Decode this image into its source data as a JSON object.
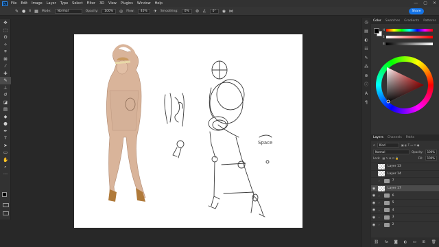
{
  "menubar": {
    "app_icon": "Ps",
    "items": [
      "File",
      "Edit",
      "Image",
      "Layer",
      "Type",
      "Select",
      "Filter",
      "3D",
      "View",
      "Plugins",
      "Window",
      "Help"
    ],
    "window_controls": [
      "—",
      "▢",
      "✕"
    ]
  },
  "options_bar": {
    "mode_label": "Mode:",
    "mode_value": "Normal",
    "opacity_label": "Opacity:",
    "opacity_value": "100%",
    "flow_label": "Flow:",
    "flow_value": "40%",
    "smoothing_label": "Smoothing:",
    "smoothing_value": "0%",
    "angle_value": "0°",
    "brush_size": "8",
    "share_label": "Share"
  },
  "toolbar": {
    "tools": [
      {
        "name": "move-tool-icon",
        "glyph": "✥"
      },
      {
        "name": "marquee-tool-icon",
        "glyph": "⬚"
      },
      {
        "name": "lasso-tool-icon",
        "glyph": "ʘ"
      },
      {
        "name": "magic-wand-tool-icon",
        "glyph": "✧"
      },
      {
        "name": "crop-tool-icon",
        "glyph": "⌗"
      },
      {
        "name": "frame-tool-icon",
        "glyph": "⊠"
      },
      {
        "name": "eyedropper-tool-icon",
        "glyph": "⁄"
      },
      {
        "name": "healing-brush-tool-icon",
        "glyph": "✚"
      },
      {
        "name": "brush-tool-icon",
        "glyph": "✎"
      },
      {
        "name": "clone-stamp-tool-icon",
        "glyph": "⊥"
      },
      {
        "name": "history-brush-tool-icon",
        "glyph": "↺"
      },
      {
        "name": "eraser-tool-icon",
        "glyph": "◪"
      },
      {
        "name": "gradient-tool-icon",
        "glyph": "▤"
      },
      {
        "name": "blur-tool-icon",
        "glyph": "◆"
      },
      {
        "name": "dodge-tool-icon",
        "glyph": "●"
      },
      {
        "name": "pen-tool-icon",
        "glyph": "✒"
      },
      {
        "name": "type-tool-icon",
        "glyph": "T"
      },
      {
        "name": "path-selection-tool-icon",
        "glyph": "➤"
      },
      {
        "name": "shape-tool-icon",
        "glyph": "▭"
      },
      {
        "name": "hand-tool-icon",
        "glyph": "✋"
      },
      {
        "name": "zoom-tool-icon",
        "glyph": "⌕"
      },
      {
        "name": "more-tools-icon",
        "glyph": "···"
      }
    ]
  },
  "canvas": {
    "sketch_text": "Space"
  },
  "color_panel": {
    "tabs": [
      "Color",
      "Swatches",
      "Gradients",
      "Patterns"
    ],
    "foreground": "#000000",
    "background": "#ffffff",
    "slider_labels": [
      "H",
      "S",
      "B"
    ],
    "hue_value": 0,
    "saturation_value": 0,
    "brightness_value": 0
  },
  "layers_panel": {
    "tabs": [
      "Layers",
      "Channels",
      "Paths"
    ],
    "search_placeholder": "Kind",
    "blend_mode": "Normal",
    "opacity_label": "Opacity:",
    "opacity_value": "100%",
    "lock_label": "Lock:",
    "fill_label": "Fill:",
    "fill_value": "100%",
    "layers": [
      {
        "name": "Layer 13",
        "type": "layer",
        "visible": false,
        "selected": false
      },
      {
        "name": "Layer 14",
        "type": "layer",
        "visible": false,
        "selected": false
      },
      {
        "name": "7",
        "type": "group",
        "visible": false,
        "selected": false
      },
      {
        "name": "Layer 17",
        "type": "layer",
        "visible": true,
        "selected": true
      },
      {
        "name": "6",
        "type": "group",
        "visible": true,
        "selected": false
      },
      {
        "name": "5",
        "type": "group",
        "visible": true,
        "selected": false
      },
      {
        "name": "4",
        "type": "group",
        "visible": true,
        "selected": false
      },
      {
        "name": "3",
        "type": "group",
        "visible": true,
        "selected": false
      },
      {
        "name": "2",
        "type": "group",
        "visible": true,
        "selected": false
      }
    ]
  }
}
